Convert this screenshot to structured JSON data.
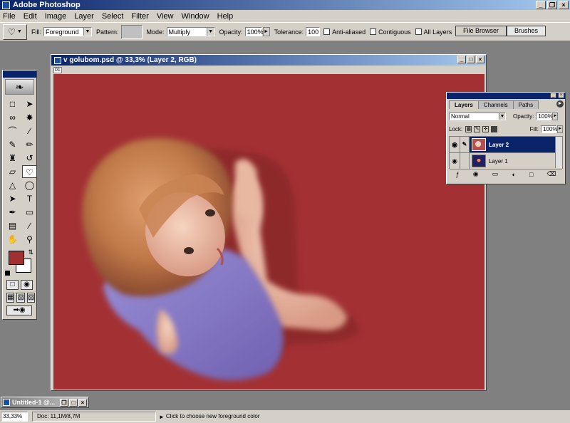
{
  "app": {
    "title": "Adobe Photoshop",
    "window_buttons": [
      "_",
      "❐",
      "×"
    ]
  },
  "menu": [
    "File",
    "Edit",
    "Image",
    "Layer",
    "Select",
    "Filter",
    "View",
    "Window",
    "Help"
  ],
  "options": {
    "tool_icon": "paint-bucket-icon",
    "fill_label": "Fill:",
    "fill_value": "Foreground",
    "pattern_label": "Pattern:",
    "mode_label": "Mode:",
    "mode_value": "Multiply",
    "opacity_label": "Opacity:",
    "opacity_value": "100%",
    "tolerance_label": "Tolerance:",
    "tolerance_value": "100",
    "anti_aliased_label": "Anti-aliased",
    "contiguous_label": "Contiguous",
    "all_layers_label": "All Layers",
    "well_tabs": [
      "File Browser",
      "Brushes"
    ]
  },
  "document": {
    "title": "v golubom.psd @ 33,3% (Layer 2, RGB)",
    "ruler_mark": "01",
    "canvas_color": "#a33134"
  },
  "colors": {
    "foreground": "#a03032",
    "background": "#ffffff",
    "title_bar": "#0a246a"
  },
  "layers_panel": {
    "tabs": [
      "Layers",
      "Channels",
      "Paths"
    ],
    "blend_mode": "Normal",
    "opacity_label": "Opacity:",
    "opacity_value": "100%",
    "lock_label": "Lock:",
    "fill_label": "Fill:",
    "fill_value": "100%",
    "layers": [
      {
        "name": "Layer 2",
        "selected": true
      },
      {
        "name": "Layer 1",
        "selected": false
      }
    ]
  },
  "minimized_doc": {
    "title": "Untitled-1 @..."
  },
  "status": {
    "zoom": "33,33%",
    "doc_size": "Doc: 11,1M/8,7M",
    "hint": "Click to choose new foreground color"
  }
}
